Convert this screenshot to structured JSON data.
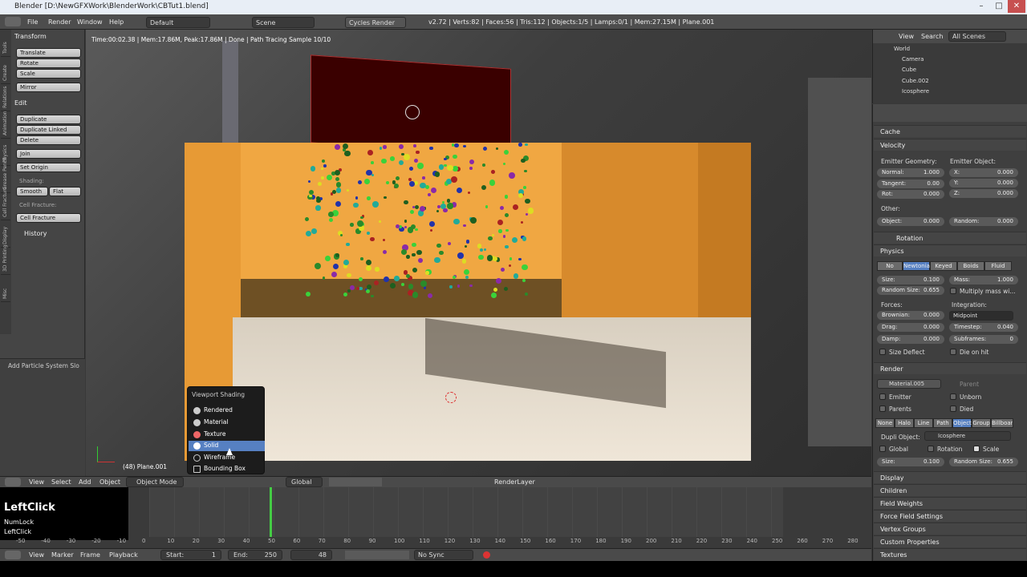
{
  "window": {
    "title": "Blender [D:\\NewGFXWork\\BlenderWork\\CBTut1.blend]",
    "min": "–",
    "max": "□",
    "close": "✕"
  },
  "info": {
    "menus": [
      "File",
      "Render",
      "Window",
      "Help"
    ],
    "layout": "Default",
    "scene": "Scene",
    "engine": "Cycles Render",
    "stats": "v2.72 | Verts:82 | Faces:56 | Tris:112 | Objects:1/5 | Lamps:0/1 | Mem:27.15M | Plane.001"
  },
  "toolshelf": {
    "tabs": [
      "Tools",
      "Create",
      "Relations",
      "Animation",
      "Physics",
      "Grease Pencil",
      "Cell Fracture",
      "Display",
      "3D Printing",
      "Misc"
    ],
    "transform_header": "Transform",
    "translate": "Translate",
    "rotate": "Rotate",
    "scale": "Scale",
    "mirror": "Mirror",
    "edit_header": "Edit",
    "duplicate": "Duplicate",
    "duplicate_linked": "Duplicate Linked",
    "delete": "Delete",
    "join": "Join",
    "set_origin": "Set Origin",
    "shading_label": "Shading:",
    "smooth": "Smooth",
    "flat": "Flat",
    "cell_fracture_label": "Cell Fracture:",
    "cell_fracture": "Cell Fracture",
    "history_header": "History",
    "operator": "Add Particle System Slo"
  },
  "viewport": {
    "status": "Time:00:02.38 | Mem:17.86M, Peak:17.86M | Done | Path Tracing Sample 10/10",
    "object_label": "(48) Plane.001"
  },
  "shading_menu": {
    "title": "Viewport Shading",
    "items": [
      "Rendered",
      "Material",
      "Texture",
      "Solid",
      "Wireframe",
      "Bounding Box"
    ],
    "selected": "Solid"
  },
  "viewport_header": {
    "view": "View",
    "select": "Select",
    "add": "Add",
    "object": "Object",
    "mode": "Object Mode",
    "orientation": "Global",
    "layer": "RenderLayer"
  },
  "timeline": {
    "ticks": [
      "-50",
      "-40",
      "-30",
      "-20",
      "-10",
      "0",
      "10",
      "20",
      "30",
      "40",
      "50",
      "60",
      "70",
      "80",
      "90",
      "100",
      "110",
      "120",
      "130",
      "140",
      "150",
      "160",
      "170",
      "180",
      "190",
      "200",
      "210",
      "220",
      "230",
      "240",
      "250",
      "260",
      "270",
      "280"
    ],
    "current": 48
  },
  "timeline_header": {
    "view": "View",
    "marker": "Marker",
    "frame": "Frame",
    "playback": "Playback",
    "start_label": "Start:",
    "start": "1",
    "end_label": "End:",
    "end": "250",
    "current": "48",
    "sync": "No Sync"
  },
  "keys": {
    "main": "LeftClick",
    "sub1": "NumLock",
    "sub2": "LeftClick"
  },
  "outliner": {
    "view": "View",
    "search": "Search",
    "scenes": "All Scenes",
    "items": [
      "World",
      "Camera",
      "Cube",
      "Cube.002",
      "Icosphere"
    ]
  },
  "props": {
    "cache": "Cache",
    "velocity": "Velocity",
    "emitter_geometry": "Emitter Geometry:",
    "emitter_object": "Emitter Object:",
    "normal_l": "Normal:",
    "normal": "1.000",
    "tangent_l": "Tangent:",
    "tangent": "0.00",
    "rot_l": "Rot:",
    "rot": "0.000",
    "x_l": "X:",
    "x": "0.000",
    "y_l": "Y:",
    "y": "0.000",
    "z_l": "Z:",
    "z": "0.000",
    "other": "Other:",
    "object_l": "Object:",
    "object_v": "0.000",
    "random_l": "Random:",
    "random_v": "0.000",
    "rotation": "Rotation",
    "physics": "Physics",
    "phys_types": [
      "No",
      "Newtonian",
      "Keyed",
      "Boids",
      "Fluid"
    ],
    "phys_selected": "Newtonian",
    "size_l": "Size:",
    "size": "0.100",
    "mass_l": "Mass:",
    "mass": "1.000",
    "rsize_l": "Random Size:",
    "rsize": "0.655",
    "multiply_mass": "Multiply mass wi...",
    "forces": "Forces:",
    "integration": "Integration:",
    "brownian_l": "Brownian:",
    "brownian": "0.000",
    "integrator": "Midpoint",
    "drag_l": "Drag:",
    "drag": "0.000",
    "timestep_l": "Timestep:",
    "timestep": "0.040",
    "damp_l": "Damp:",
    "damp": "0.000",
    "subframes_l": "Subframes:",
    "subframes": "0",
    "size_deflect": "Size Deflect",
    "die_on_hit": "Die on hit",
    "render": "Render",
    "material": "Material.005",
    "parent": "Parent",
    "emitter": "Emitter",
    "unborn": "Unborn",
    "parents": "Parents",
    "died": "Died",
    "render_types": [
      "None",
      "Halo",
      "Line",
      "Path",
      "Object",
      "Group",
      "Billboar"
    ],
    "render_selected": "Object",
    "dupli_object_l": "Dupli Object:",
    "dupli_object": "Icosphere",
    "global": "Global",
    "rotation2": "Rotation",
    "scale": "Scale",
    "size2_l": "Size:",
    "size2": "0.100",
    "rsize2_l": "Random Size:",
    "rsize2": "0.655",
    "collapsed": [
      "Display",
      "Children",
      "Field Weights",
      "Force Field Settings",
      "Vertex Groups",
      "Custom Properties",
      "Textures"
    ]
  }
}
